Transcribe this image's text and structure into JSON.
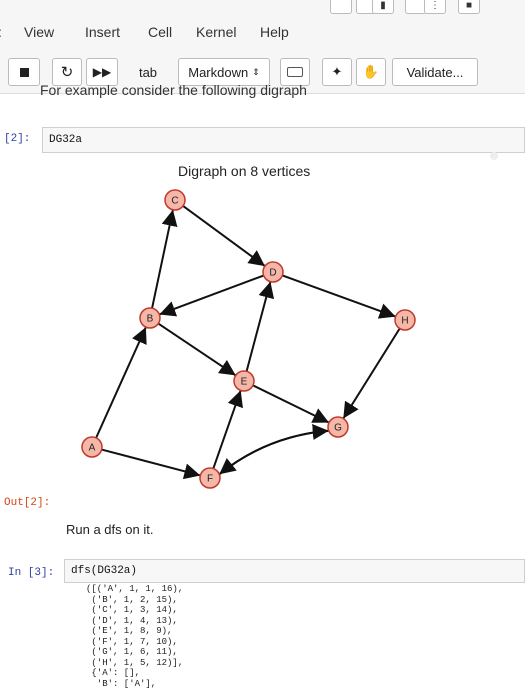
{
  "menu": {
    "items": [
      "View",
      "Insert",
      "Cell",
      "Kernel",
      "Help"
    ]
  },
  "toolbar": {
    "tab_label": "tab",
    "cell_type": "Markdown",
    "validate_label": "Validate..."
  },
  "cells": {
    "prev_text": "For example consider the following digraph",
    "in2_prompt": "[2]:",
    "in2_code": "DG32a",
    "plot_title": "Digraph on 8 vertices",
    "out2_prompt": "Out[2]:",
    "md_text": "Run a dfs on it.",
    "in3_prompt": "In [3]:",
    "in3_code": "dfs(DG32a)",
    "output_lines": [
      "([('A', 1, 1, 16),",
      " ('B', 1, 2, 15),",
      " ('C', 1, 3, 14),",
      " ('D', 1, 4, 13),",
      " ('E', 1, 8, 9),",
      " ('F', 1, 7, 10),",
      " ('G', 1, 6, 11),",
      " ('H', 1, 5, 12)],",
      " {'A': [],",
      "  'B': ['A'],"
    ]
  },
  "graph": {
    "nodes": [
      "A",
      "B",
      "C",
      "D",
      "E",
      "F",
      "G",
      "H"
    ],
    "edges": [
      [
        "A",
        "B"
      ],
      [
        "A",
        "F"
      ],
      [
        "B",
        "C"
      ],
      [
        "B",
        "E"
      ],
      [
        "C",
        "D"
      ],
      [
        "D",
        "B"
      ],
      [
        "D",
        "H"
      ],
      [
        "E",
        "D"
      ],
      [
        "E",
        "G"
      ],
      [
        "F",
        "E"
      ],
      [
        "F",
        "G"
      ],
      [
        "G",
        "F"
      ],
      [
        "H",
        "G"
      ]
    ],
    "node_fill": "#f4b7a8",
    "node_stroke": "#c0392b"
  }
}
